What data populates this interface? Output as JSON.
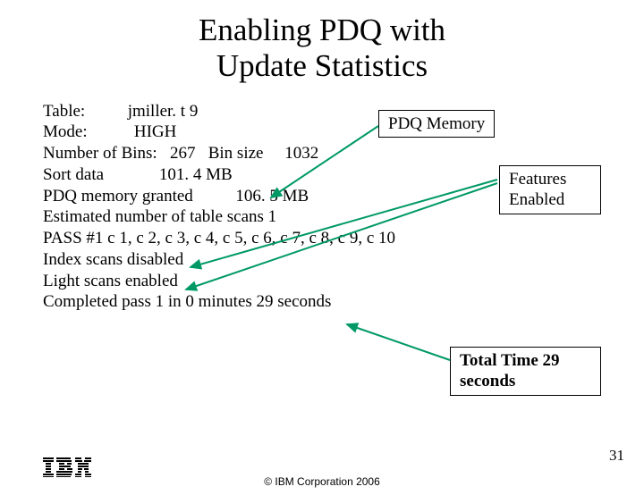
{
  "title_line1": "Enabling PDQ with",
  "title_line2": "Update Statistics",
  "stats": {
    "table_label": "Table:",
    "table_value": "jmiller. t 9",
    "mode_label": "Mode:",
    "mode_value": "HIGH",
    "bins_label": "Number of Bins:",
    "bins_value": "267",
    "binsize_label": "Bin size",
    "binsize_value": "1032",
    "sort_label": "Sort data",
    "sort_value": "101. 4 MB",
    "pdq_label": "PDQ memory granted",
    "pdq_value": "106. 5 MB",
    "scans_line": "Estimated number of table scans 1",
    "pass_line": "PASS #1 c 1, c 2, c 3, c 4, c 5, c 6, c 7, c 8, c 9, c 10",
    "index_line": "Index scans disabled",
    "light_line": "Light scans enabled",
    "complete_line": "Completed pass 1 in 0 minutes 29 seconds"
  },
  "callouts": {
    "pdq_memory": "PDQ Memory",
    "features": "Features Enabled",
    "total": "Total Time 29 seconds"
  },
  "page_number": "31",
  "copyright": "© IBM Corporation 2006"
}
